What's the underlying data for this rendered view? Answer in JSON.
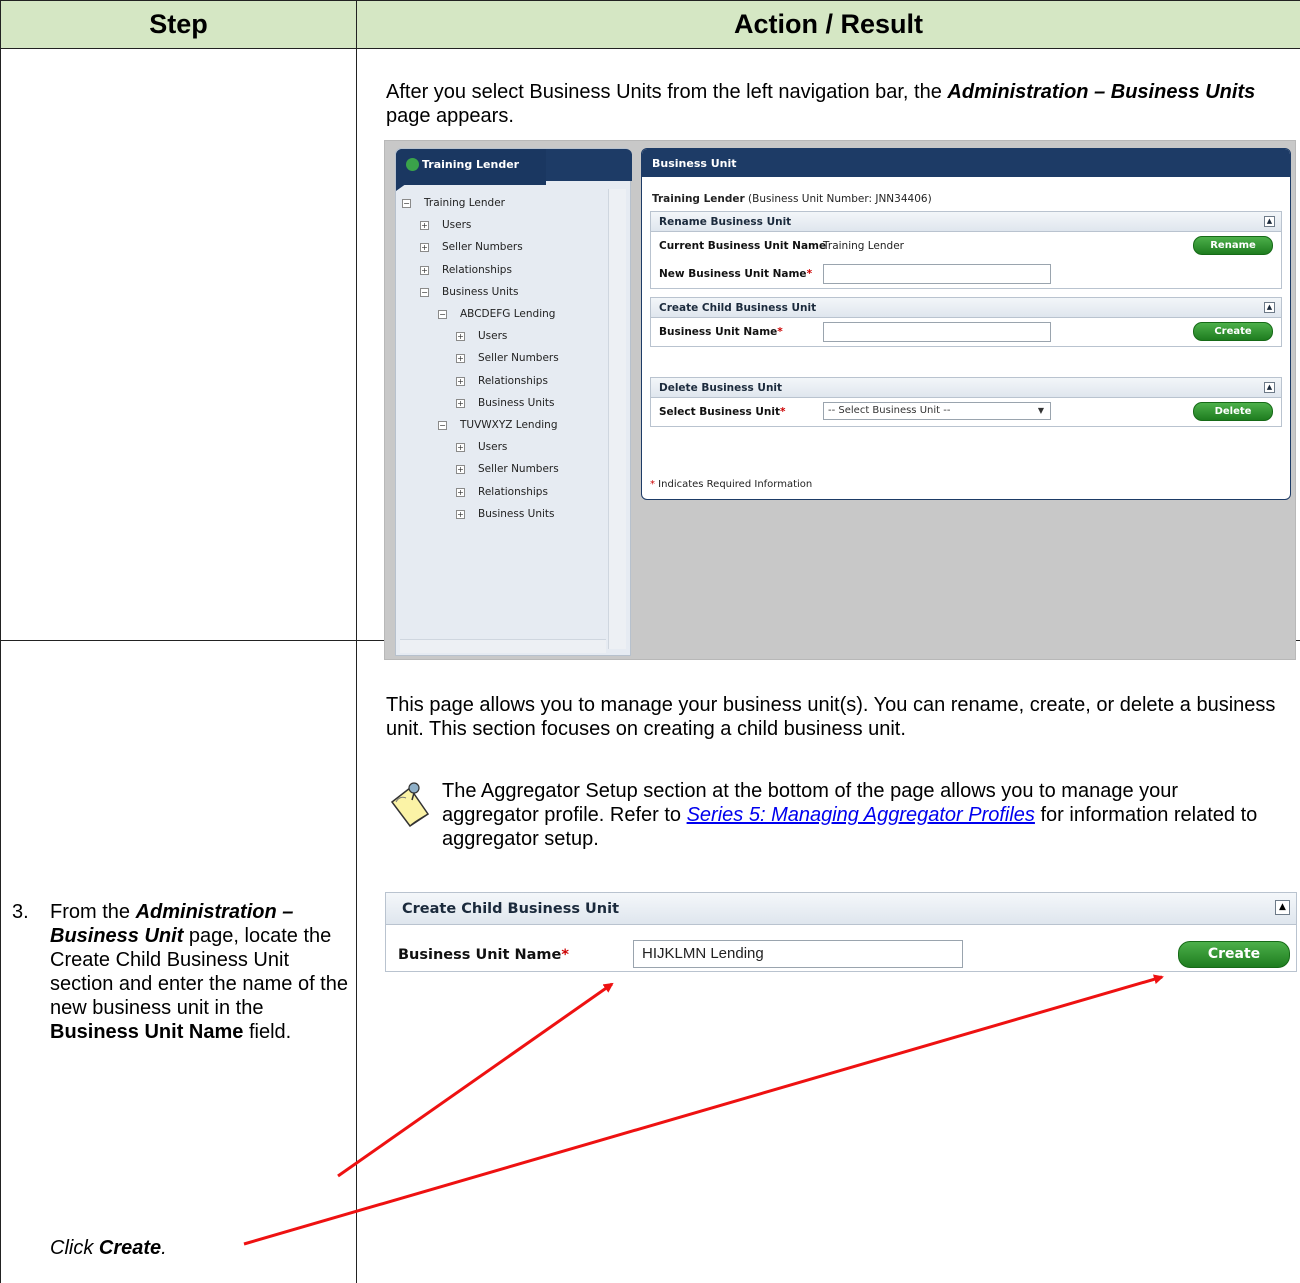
{
  "table": {
    "header_step": "Step",
    "header_action": "Action / Result"
  },
  "row1": {
    "intro_a": "After you select Business Units from the left navigation bar, the ",
    "intro_b": "Administration – Business Units",
    "intro_c": " page appears.",
    "para2": "This page allows you to manage your business unit(s). You can rename, create, or delete a business unit.  This section focuses on creating a child business unit.",
    "note_a": "The Aggregator Setup section at the bottom of the page allows you to manage your aggregator profile. Refer to ",
    "note_link": "Series 5: Managing Aggregator Profiles",
    "note_b": " for information related to aggregator setup."
  },
  "screenshot1": {
    "tree": {
      "title": "Training Lender",
      "items": [
        {
          "label": "Training Lender",
          "box": "−"
        },
        {
          "label": "Users",
          "box": "+"
        },
        {
          "label": "Seller Numbers",
          "box": "+"
        },
        {
          "label": "Relationships",
          "box": "+"
        },
        {
          "label": "Business Units",
          "box": "−"
        },
        {
          "label": "ABCDEFG Lending",
          "box": "−"
        },
        {
          "label": "Users",
          "box": "+"
        },
        {
          "label": "Seller Numbers",
          "box": "+"
        },
        {
          "label": "Relationships",
          "box": "+"
        },
        {
          "label": "Business Units",
          "box": "+"
        },
        {
          "label": "TUVWXYZ Lending",
          "box": "−"
        },
        {
          "label": "Users",
          "box": "+"
        },
        {
          "label": "Seller Numbers",
          "box": "+"
        },
        {
          "label": "Relationships",
          "box": "+"
        },
        {
          "label": "Business Units",
          "box": "+"
        }
      ]
    },
    "panel": {
      "title": "Business Unit",
      "lender_name": "Training Lender",
      "lender_number": " (Business Unit Number: JNN34406)",
      "rename": {
        "heading": "Rename Business Unit",
        "current_label": "Current Business Unit Name",
        "current_value": "Training Lender",
        "button": "Rename",
        "new_label": "New Business Unit Name"
      },
      "create": {
        "heading": "Create Child Business Unit",
        "label": "Business Unit Name",
        "button": "Create"
      },
      "delete": {
        "heading": "Delete Business Unit",
        "label": "Select Business Unit",
        "select_value": "-- Select Business Unit --",
        "button": "Delete"
      },
      "required_mark": "*",
      "required_note": " Indicates Required Information"
    }
  },
  "row2": {
    "step_number": "3.",
    "step_a": "From the ",
    "step_b": "Administration – Business Unit",
    "step_c": " page, locate the Create Child Business Unit section and enter the name of the new business unit in the ",
    "step_d": "Business Unit Name",
    "step_e": " field.",
    "click_a": "Click ",
    "click_b": "Create",
    "click_c": "."
  },
  "screenshot2": {
    "heading": "Create Child Business Unit",
    "label": "Business Unit Name",
    "required_mark": "*",
    "input_value": "HIJKLMN Lending",
    "button": "Create"
  },
  "colors": {
    "header_bg": "#d5e7c4",
    "nav_blue": "#1d3b66",
    "button_green": "#2e8f2e",
    "arrow_red": "#ee1111",
    "link_blue": "#0000ee"
  }
}
